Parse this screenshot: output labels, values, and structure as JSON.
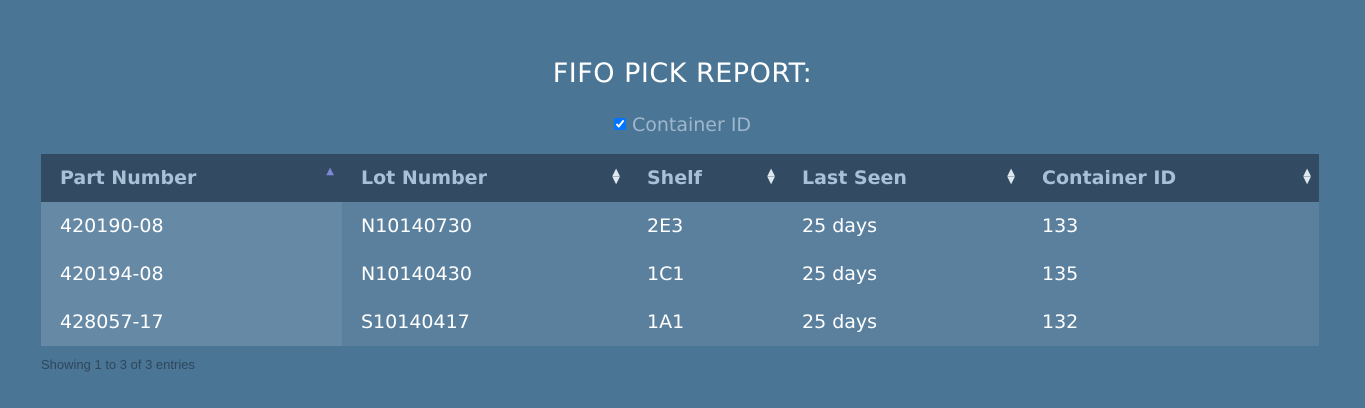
{
  "title": "FIFO PICK REPORT:",
  "column_toggle": {
    "label": "Container ID",
    "checked": true
  },
  "table": {
    "columns": [
      "Part Number",
      "Lot Number",
      "Shelf",
      "Last Seen",
      "Container ID"
    ],
    "sorted_column": "Part Number",
    "sort_direction": "ascending",
    "rows": [
      [
        "420190-08",
        "N10140730",
        "2E3",
        "25 days",
        "133"
      ],
      [
        "420194-08",
        "N10140430",
        "1C1",
        "25 days",
        "135"
      ],
      [
        "428057-17",
        "S10140417",
        "1A1",
        "25 days",
        "132"
      ]
    ]
  },
  "info": "Showing 1 to 3 of 3 entries",
  "colors": {
    "background": "#4a7595",
    "header": "#324b63",
    "sorted_cell": "#668aa5",
    "cell": "#5a809e",
    "sort_active": "#7e86d8"
  }
}
